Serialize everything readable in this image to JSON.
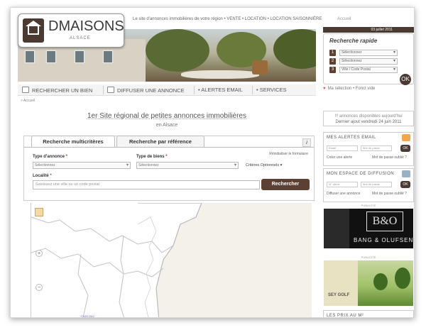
{
  "header": {
    "logo_text": "DMAISONS",
    "logo_sub": "ALSACE",
    "tagline": "Le site d'annonces immobilières de votre région • VENTE • LOCATION • LOCATION SAISONNIÈRE",
    "home_link": "Accueil",
    "date": "03 juillet 2011"
  },
  "quick_search": {
    "title": "Recherche rapide",
    "rows": [
      {
        "num": "1",
        "value": "Sélectionnez"
      },
      {
        "num": "2",
        "value": "Sélectionnez"
      },
      {
        "num": "3",
        "value": "Ville / Code Postal"
      }
    ],
    "go_label": "OK"
  },
  "nav": {
    "items": [
      "RECHERCHER UN BIEN",
      "DIFFUSER UNE ANNONCE",
      "• ALERTES EMAIL",
      "• SERVICES"
    ]
  },
  "selection": {
    "label": "Ma sélection",
    "sep": "•",
    "tool": "Fonct vide"
  },
  "breadcrumb": "> Accueil",
  "headline": {
    "text": "1er Site régional de petites annonces immobilières",
    "region": "en Alsace"
  },
  "stats": {
    "line1": "!!! annonces disponibles aujourd'hui",
    "line2": "Dernier ajout vendredi 24 juin 2011"
  },
  "email_alerts": {
    "title": "MES ALERTES EMAIL",
    "field1": "Email",
    "field2": "Mot de passe",
    "ok": "OK",
    "link1": "Créer une alerte",
    "link2": "Mot de passe oublié ?"
  },
  "diffusion": {
    "title": "MON ESPACE DE DIFFUSION",
    "field1": "N° client",
    "field2": "Mot de passe",
    "ok": "OK",
    "link1": "Diffuser une annonce",
    "link2": "Mot de passe oublié ?"
  },
  "ads": {
    "label": "PUBLICITÉ",
    "ad1_logo": "B&O",
    "ad1_name": "BANG & OLUFSEN",
    "ad2_name": "SEY GOLF"
  },
  "last_box": "LES PRIX AU M²",
  "search_panel": {
    "tab1": "Recherche multicritères",
    "tab2": "Recherche par référence",
    "info": "i",
    "reset": "Réinitialiser le formulaire",
    "type_annonce_label": "Type d'annonce",
    "type_annonce_value": "Sélectionnez",
    "type_bien_label": "Type de biens",
    "type_bien_value": "Sélectionnez",
    "required": "*",
    "criteria": "Critères Optionnels ▾",
    "localite_label": "Localité",
    "localite_placeholder": "Saisissez une ville ou un code postal",
    "search_btn": "Rechercher"
  },
  "map": {
    "credit": "© IGN 2010",
    "zoom_in": "+",
    "zoom_out": "−"
  }
}
